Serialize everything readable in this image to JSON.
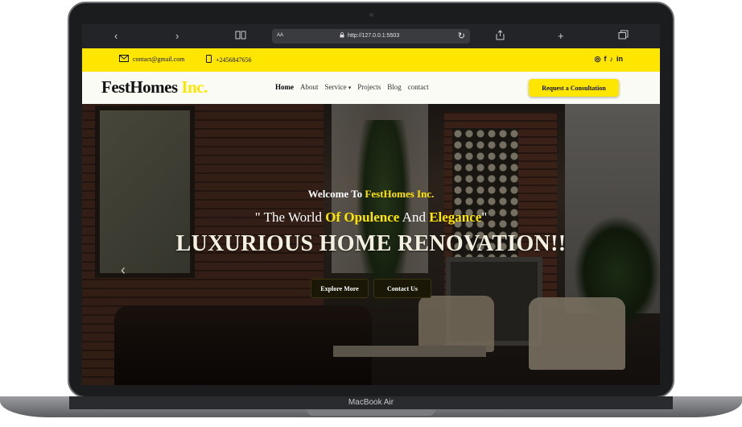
{
  "device": {
    "label": "MacBook Air"
  },
  "browser": {
    "text_size_label": "AA",
    "url": "http://127.0.0.1:5503",
    "icons": [
      "back-icon",
      "forward-icon",
      "book-icon",
      "lock-icon",
      "reload-icon",
      "share-icon",
      "new-tab-icon",
      "tabs-icon"
    ]
  },
  "topbar": {
    "email": "contact@gmail.com",
    "phone": "+2456847656",
    "social_icons": [
      "instagram-icon",
      "facebook-icon",
      "tiktok-icon",
      "linkedin-icon"
    ],
    "social_glyphs": {
      "instagram": "◎",
      "facebook": "f",
      "tiktok": "♪",
      "linkedin": "in"
    }
  },
  "nav": {
    "logo_main": "FestHomes",
    "logo_accent": "Inc.",
    "items": [
      "Home",
      "About",
      "Service",
      "Projects",
      "Blog",
      "contact"
    ],
    "active": "Home",
    "dropdown_glyph": "▾",
    "cta_label": "Request a Consultation"
  },
  "hero": {
    "welcome_prefix": "Welcome To ",
    "welcome_brand": "FestHomes Inc.",
    "tagline_open": "\" The World ",
    "tagline_hl1": "Of Opulence",
    "tagline_mid": " And ",
    "tagline_hl2": "Elegance",
    "tagline_close": "\"",
    "headline": "LUXURIOUS HOME RENOVATION!!",
    "btn_explore": "Explore More",
    "btn_contact": "Contact Us",
    "prev_arrow": "‹"
  },
  "colors": {
    "accent": "#ffe600",
    "dark": "#111111",
    "button_dark": "#1a1706"
  }
}
